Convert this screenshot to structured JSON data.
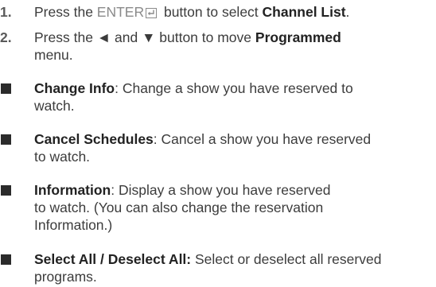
{
  "steps": [
    {
      "num": "1.",
      "pre": "Press the ",
      "enter_label": "ENTER",
      "mid": " button to select ",
      "target": "Channel List",
      "post": "."
    },
    {
      "num": "2.",
      "pre": "Press the ",
      "left_arrow": "◄",
      "and": " and ",
      "down_arrow": "▼",
      "mid": " button to move ",
      "target": "Programmed",
      "post": "menu."
    }
  ],
  "bullets": [
    {
      "term": "Change Info",
      "sep": ": ",
      "line1": "Change a show you have reserved to",
      "line2": "watch."
    },
    {
      "term": "Cancel Schedules",
      "sep": ": ",
      "line1": "Cancel a show you have reserved",
      "line2": "to watch."
    },
    {
      "term": "Information",
      "sep": ": ",
      "line1": "Display a show you have reserved",
      "line2": "to watch. (You can also change the reservation",
      "line3": "Information.)"
    },
    {
      "term": "Select All / Deselect All:",
      "sep": " ",
      "line1": "Select or deselect all reserved",
      "line2": "programs."
    }
  ],
  "icons": {
    "enter_icon": "enter-return-icon",
    "bullet_icon": "square-bullet-icon"
  },
  "colors": {
    "text": "#3c3c3c",
    "bold": "#222222",
    "enter": "#8a8a8a",
    "bullet": "#2b2b2b"
  }
}
